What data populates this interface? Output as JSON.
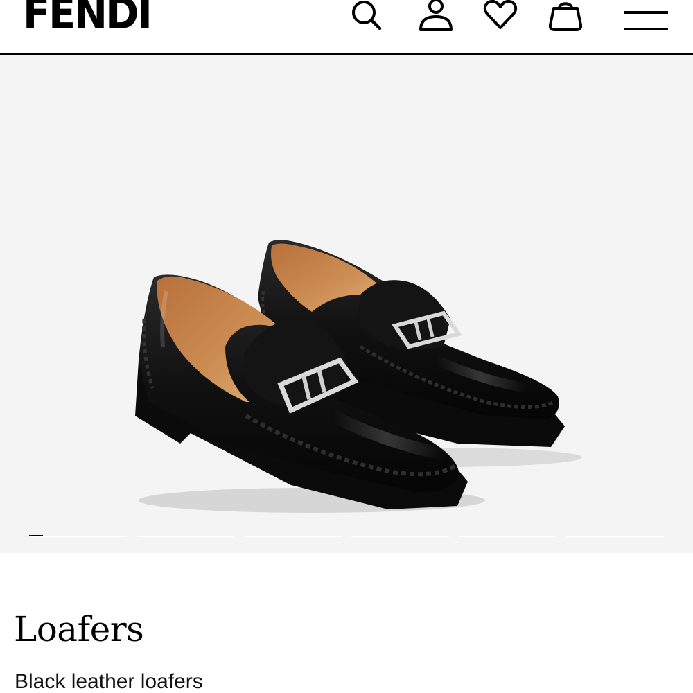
{
  "header": {
    "brand": "FENDI",
    "icons": [
      "search-icon",
      "user-icon",
      "heart-icon",
      "bag-icon",
      "menu-icon"
    ]
  },
  "gallery": {
    "image_alt": "Black leather loafers with silver FF buckle",
    "slide_count": 6,
    "current_slide": 1
  },
  "product": {
    "title": "Loafers",
    "subtitle": "Black leather loafers"
  },
  "colors": {
    "accent": "#000000",
    "gallery_background": "#f4f4f4",
    "lining": "#c8864e"
  }
}
